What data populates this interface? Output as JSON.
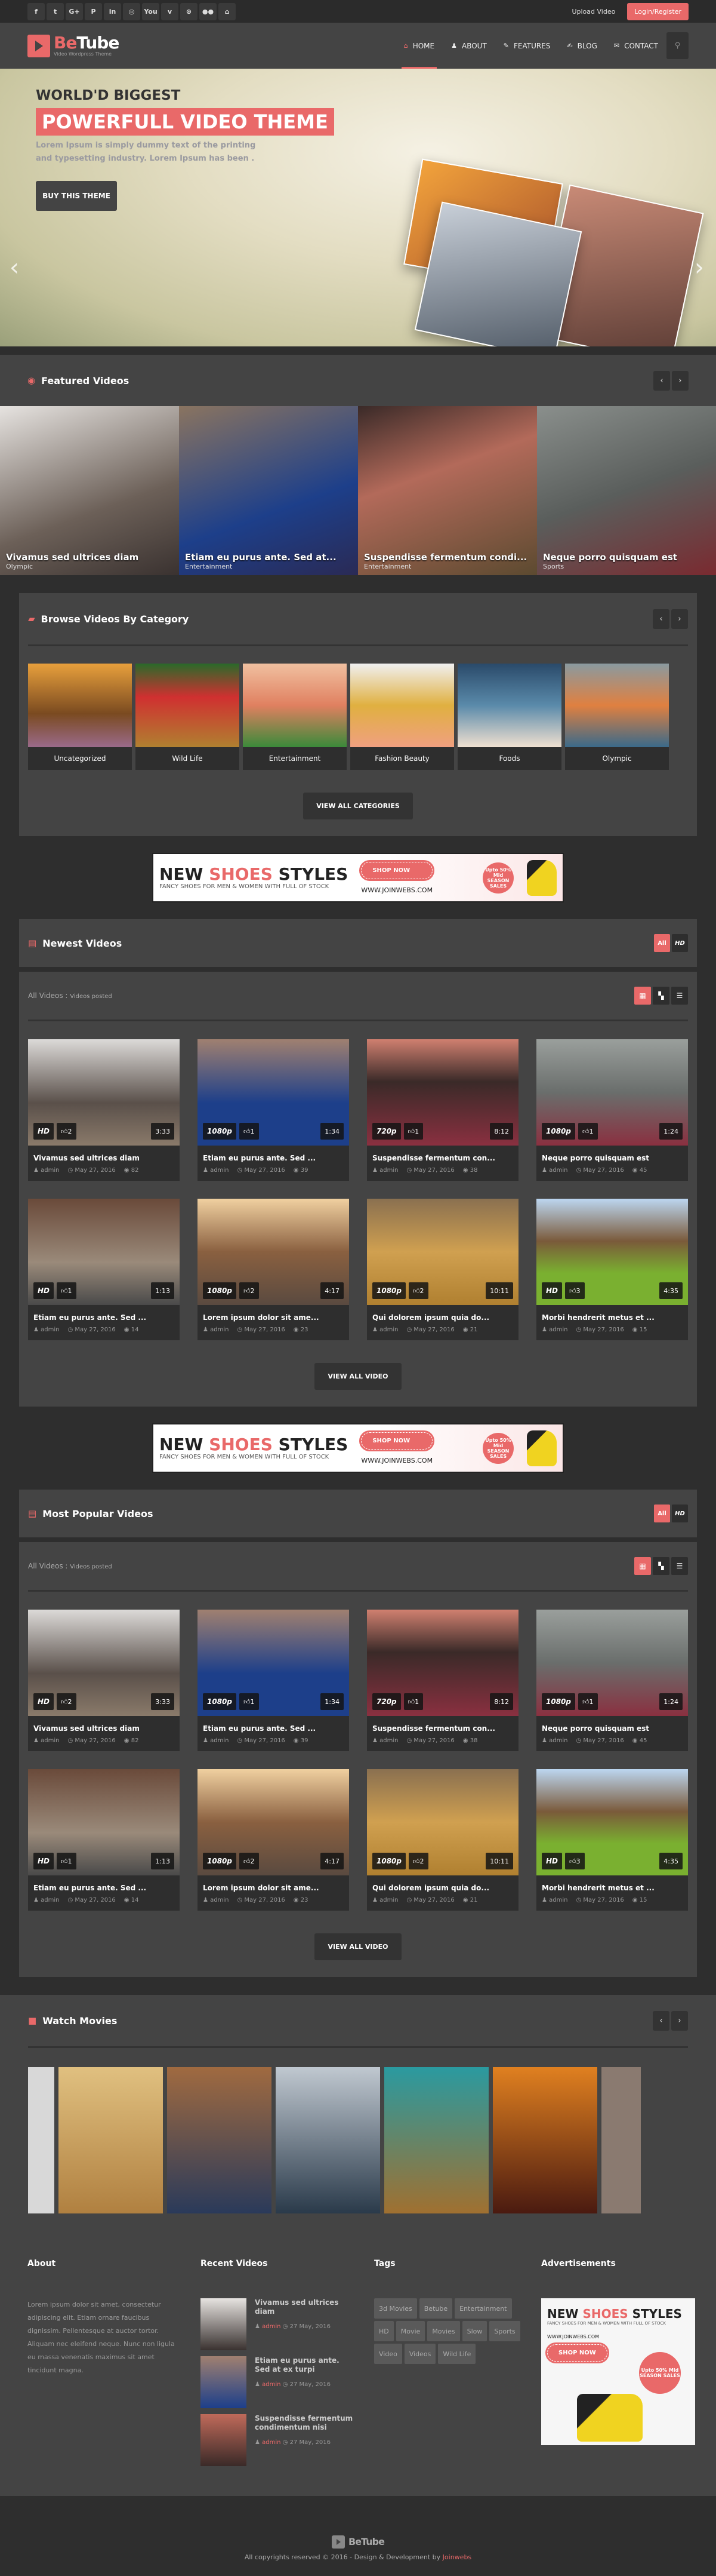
{
  "topbar": {
    "socials": [
      "f",
      "t",
      "G+",
      "P",
      "in",
      "◎",
      "You",
      "v",
      "⊛",
      "●●",
      "⌂"
    ],
    "social_names": [
      "facebook",
      "twitter",
      "google-plus",
      "pinterest",
      "linkedin",
      "instagram",
      "youtube",
      "vimeo",
      "dribbble",
      "flickr",
      "github"
    ],
    "upload": "Upload Video",
    "login": "Login/Register"
  },
  "brand": {
    "name_a": "Be",
    "name_b": "Tube",
    "tagline": "Video Wordpress Theme"
  },
  "nav": [
    {
      "label": "HOME",
      "icon": "⌂"
    },
    {
      "label": "ABOUT",
      "icon": "♟"
    },
    {
      "label": "FEATURES",
      "icon": "✎"
    },
    {
      "label": "BLOG",
      "icon": "✍"
    },
    {
      "label": "CONTACT",
      "icon": "✉"
    }
  ],
  "hero": {
    "sub": "WORLD'D BIGGEST",
    "title": "POWERFULL VIDEO THEME",
    "desc": "Lorem Ipsum is simply dummy text of the printing and typesetting industry. Lorem Ipsum has been .",
    "button": "BUY THIS THEME"
  },
  "featured": {
    "title": "Featured Videos",
    "items": [
      {
        "title": "Vivamus sed ultrices diam",
        "cat": "Olympic"
      },
      {
        "title": "Etiam eu purus ante. Sed at...",
        "cat": "Entertainment"
      },
      {
        "title": "Suspendisse fermentum condi...",
        "cat": "Entertainment"
      },
      {
        "title": "Neque porro quisquam est",
        "cat": "Sports"
      }
    ]
  },
  "categories": {
    "title": "Browse Videos By Category",
    "items": [
      "Uncategorized",
      "Wild Life",
      "Entertainment",
      "Fashion Beauty",
      "Foods",
      "Olympic"
    ],
    "button": "VIEW ALL CATEGORIES"
  },
  "banner": {
    "h1": "NEW ",
    "h2": "SHOES",
    "h3": " STYLES",
    "sub": "FANCY SHOES FOR MEN & WOMEN WITH FULL OF STOCK",
    "shop": "SHOP NOW",
    "site": "WWW.JOINWEBS.COM",
    "sale": "Upto 50% Mid SEASON SALES"
  },
  "newest": {
    "title": "Newest Videos",
    "tabs": [
      "All",
      "HD"
    ],
    "all_label": "All Videos :",
    "posted": "Videos posted",
    "button": "VIEW ALL VIDEO"
  },
  "popular": {
    "title": "Most Popular Videos",
    "tabs": [
      "All",
      "HD"
    ],
    "all_label": "All Videos :",
    "posted": "Videos posted",
    "button": "VIEW ALL VIDEO"
  },
  "videos": [
    {
      "q": "HD",
      "likes": "2",
      "dur": "3:33",
      "title": "Vivamus sed ultrices diam",
      "author": "admin",
      "date": "May 27, 2016",
      "views": "82"
    },
    {
      "q": "1080p",
      "likes": "1",
      "dur": "1:34",
      "title": "Etiam eu purus ante. Sed ...",
      "author": "admin",
      "date": "May 27, 2016",
      "views": "39"
    },
    {
      "q": "720p",
      "likes": "1",
      "dur": "8:12",
      "title": "Suspendisse fermentum con...",
      "author": "admin",
      "date": "May 27, 2016",
      "views": "38"
    },
    {
      "q": "1080p",
      "likes": "1",
      "dur": "1:24",
      "title": "Neque porro quisquam est",
      "author": "admin",
      "date": "May 27, 2016",
      "views": "45"
    },
    {
      "q": "HD",
      "likes": "1",
      "dur": "1:13",
      "title": "Etiam eu purus ante. Sed ...",
      "author": "admin",
      "date": "May 27, 2016",
      "views": "14"
    },
    {
      "q": "1080p",
      "likes": "2",
      "dur": "4:17",
      "title": "Lorem ipsum dolor sit ame...",
      "author": "admin",
      "date": "May 27, 2016",
      "views": "23"
    },
    {
      "q": "1080p",
      "likes": "2",
      "dur": "10:11",
      "title": "Qui dolorem ipsum quia do...",
      "author": "admin",
      "date": "May 27, 2016",
      "views": "21"
    },
    {
      "q": "HD",
      "likes": "3",
      "dur": "4:35",
      "title": "Morbi hendrerit metus et ...",
      "author": "admin",
      "date": "May 27, 2016",
      "views": "15"
    }
  ],
  "movies": {
    "title": "Watch Movies"
  },
  "footer": {
    "about_title": "About",
    "about_text": "Lorem ipsum dolor sit amet, consectetur adipiscing elit. Etiam ornare faucibus dignissim. Pellentesque at auctor tortor. Aliquam nec eleifend neque. Nunc non ligula eu massa venenatis maximus sit amet tincidunt magna.",
    "recent_title": "Recent Videos",
    "recent": [
      {
        "title": "Vivamus sed ultrices diam",
        "author": "admin",
        "date": "27 May, 2016"
      },
      {
        "title": "Etiam eu purus ante. Sed at ex turpi",
        "author": "admin",
        "date": "27 May, 2016"
      },
      {
        "title": "Suspendisse fermentum condimentum nisi",
        "author": "admin",
        "date": "27 May, 2016"
      }
    ],
    "tags_title": "Tags",
    "tags": [
      "3d Movies",
      "Betube",
      "Entertainment",
      "HD",
      "Movie",
      "Movies",
      "Slow",
      "Sports",
      "Video",
      "Videos",
      "Wild Life"
    ],
    "ads_title": "Advertisements",
    "copyright": "All copyrights reserved © 2016 - Design & Development by ",
    "credit": "Joinwebs"
  },
  "colors": {
    "accent": "#e96969",
    "panel": "#444444",
    "bg": "#2e2e2e"
  }
}
